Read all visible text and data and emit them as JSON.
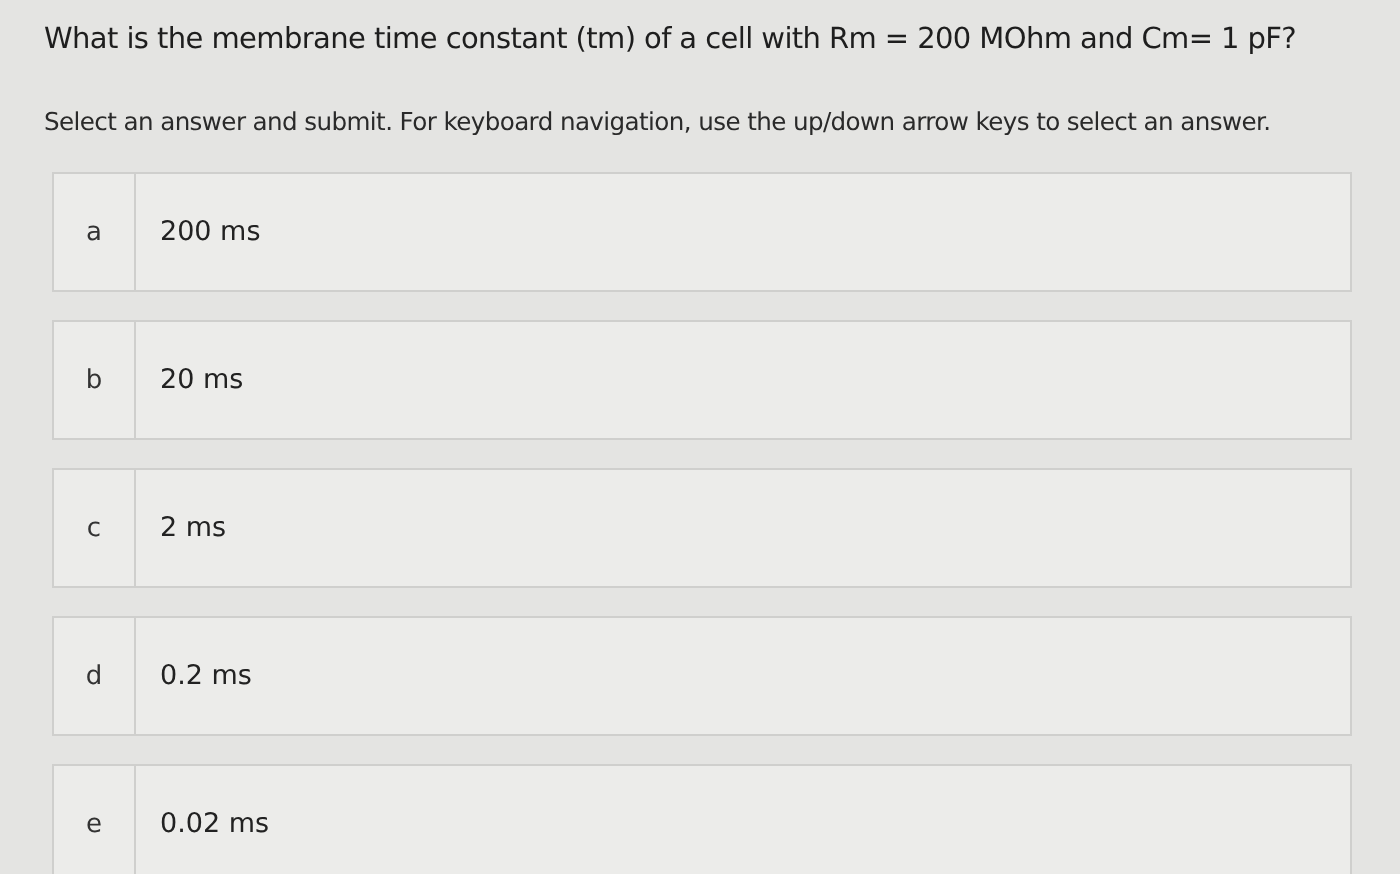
{
  "question": "What is the membrane time constant (tm) of a cell with Rm = 200 MOhm and Cm= 1 pF?",
  "instruction": "Select an answer and submit. For keyboard navigation, use the up/down arrow keys to select an answer.",
  "options": [
    {
      "letter": "a",
      "text": "200 ms",
      "selected": false
    },
    {
      "letter": "b",
      "text": "20 ms",
      "selected": false
    },
    {
      "letter": "c",
      "text": "2 ms",
      "selected": false
    },
    {
      "letter": "d",
      "text": "0.2 ms",
      "selected": false
    },
    {
      "letter": "e",
      "text": "0.02 ms",
      "selected": false
    }
  ]
}
